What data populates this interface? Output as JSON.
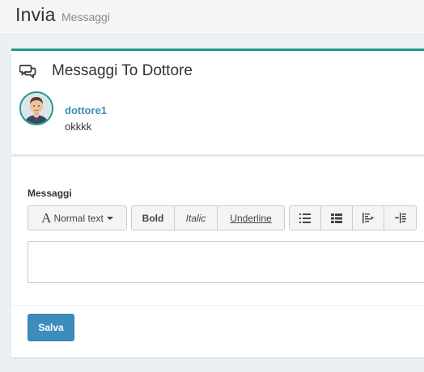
{
  "header": {
    "title": "Invia",
    "subtitle": "Messaggi"
  },
  "messages_box": {
    "icon": "comments-icon",
    "title": "Messaggi To Dottore",
    "accent_color": "#1e9a89",
    "items": [
      {
        "username": "dottore1",
        "text": "okkkk",
        "avatar": "doctor-avatar"
      }
    ]
  },
  "form": {
    "label": "Messaggi",
    "toolbar": {
      "font_size_label": "Normal text",
      "bold_label": "Bold",
      "italic_label": "Italic",
      "underline_label": "Underline",
      "list_icons": [
        "unordered-list-icon",
        "ordered-list-icon",
        "outdent-icon",
        "indent-icon"
      ]
    },
    "editor_value": "",
    "save_label": "Salva",
    "save_color": "#3c8dbc"
  }
}
